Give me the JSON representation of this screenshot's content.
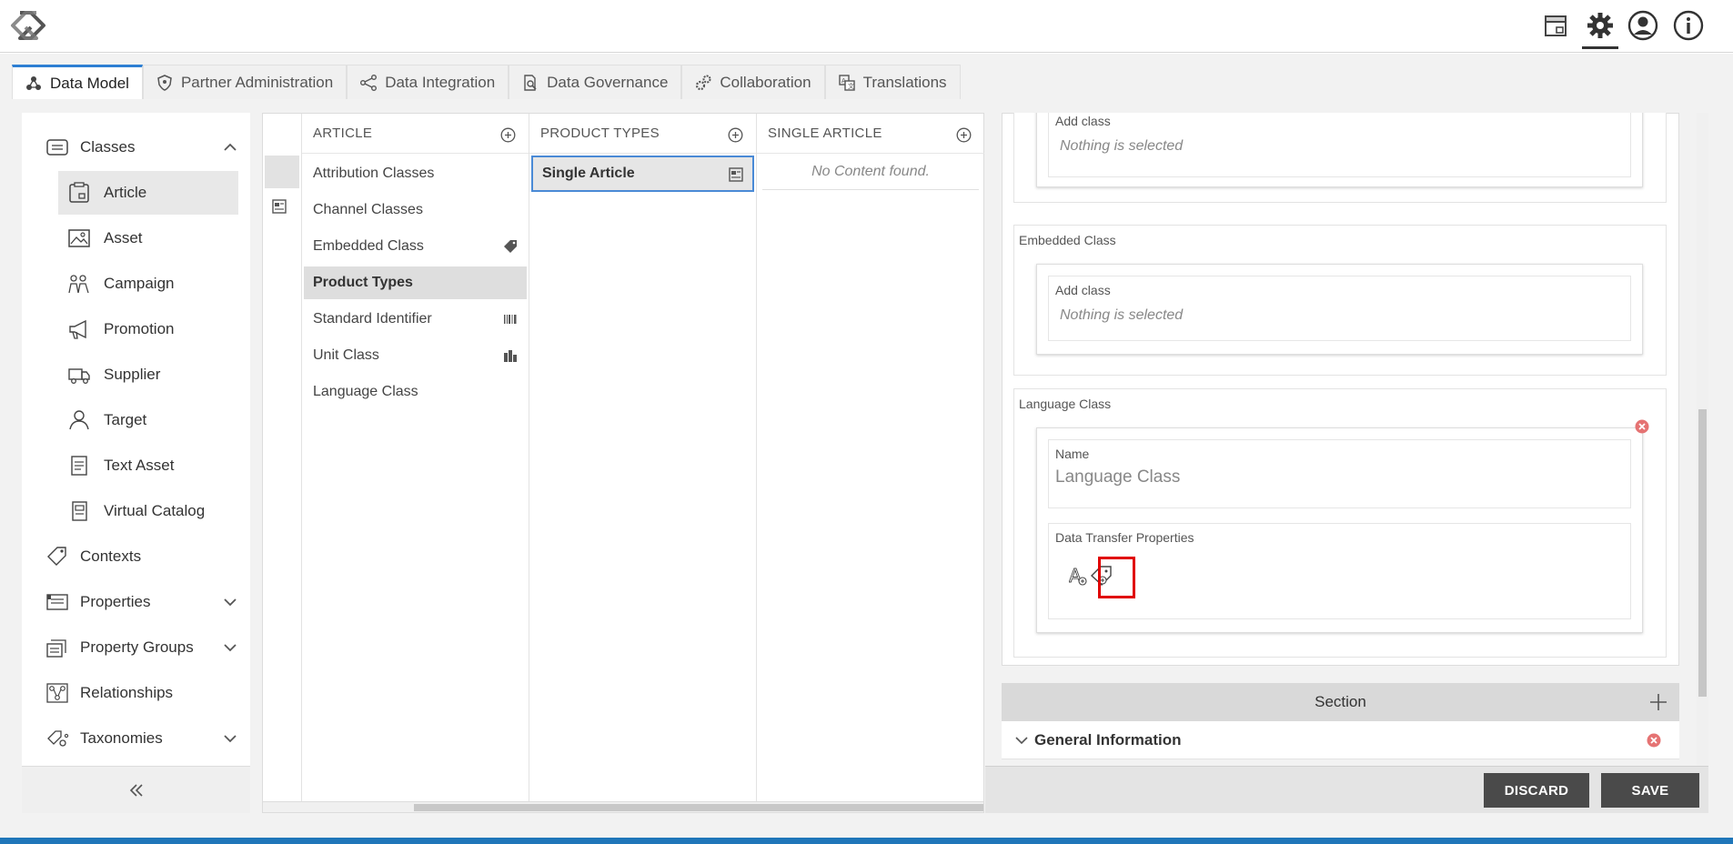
{
  "header": {
    "icons": [
      "logo-icon",
      "package-icon",
      "gear-icon",
      "user-icon",
      "info-icon"
    ]
  },
  "tabs": [
    {
      "label": "Data Model",
      "icon": "network-icon",
      "active": true
    },
    {
      "label": "Partner Administration",
      "icon": "shield-icon"
    },
    {
      "label": "Data Integration",
      "icon": "share-icon"
    },
    {
      "label": "Data Governance",
      "icon": "document-search-icon"
    },
    {
      "label": "Collaboration",
      "icon": "gears-icon"
    },
    {
      "label": "Translations",
      "icon": "translate-icon"
    }
  ],
  "sidebar": {
    "items": [
      {
        "label": "Classes",
        "icon": "classes-icon",
        "expanded": true
      },
      {
        "label": "Article",
        "icon": "article-icon",
        "selected": true
      },
      {
        "label": "Asset",
        "icon": "image-icon"
      },
      {
        "label": "Campaign",
        "icon": "campaign-icon"
      },
      {
        "label": "Promotion",
        "icon": "megaphone-icon"
      },
      {
        "label": "Supplier",
        "icon": "truck-icon"
      },
      {
        "label": "Target",
        "icon": "person-icon"
      },
      {
        "label": "Text Asset",
        "icon": "text-document-icon"
      },
      {
        "label": "Virtual Catalog",
        "icon": "catalog-icon"
      },
      {
        "label": "Contexts",
        "icon": "tag-icon"
      },
      {
        "label": "Properties",
        "icon": "properties-icon",
        "expandable": true
      },
      {
        "label": "Property Groups",
        "icon": "property-groups-icon",
        "expandable": true
      },
      {
        "label": "Relationships",
        "icon": "relationships-icon"
      },
      {
        "label": "Taxonomies",
        "icon": "taxonomy-icon",
        "expandable": true
      }
    ],
    "collapse_icon": "double-chevron-left-icon"
  },
  "columns": {
    "article": {
      "header": "ARTICLE",
      "rows": [
        {
          "label": "Attribution Classes"
        },
        {
          "label": "Channel Classes"
        },
        {
          "label": "Embedded Class",
          "icon": "tag-icon"
        },
        {
          "label": "Product Types",
          "selected": true
        },
        {
          "label": "Standard Identifier",
          "icon": "barcode-icon"
        },
        {
          "label": "Unit Class",
          "icon": "units-icon"
        },
        {
          "label": "Language Class"
        }
      ]
    },
    "product_types": {
      "header": "PRODUCT TYPES",
      "rows": [
        {
          "label": "Single Article",
          "icon": "form-icon",
          "selected": true
        }
      ]
    },
    "single_article": {
      "header": "SINGLE ARTICLE",
      "empty_text": "No Content found."
    }
  },
  "detail": {
    "top_block": {
      "field_label": "Add class",
      "field_value": "Nothing is selected"
    },
    "embedded_block": {
      "title": "Embedded Class",
      "field_label": "Add class",
      "field_value": "Nothing is selected"
    },
    "language_block": {
      "title": "Language Class",
      "name_label": "Name",
      "name_value": "Language Class",
      "dtp_label": "Data Transfer Properties",
      "dtp_icons": [
        "text-property-icon",
        "tag-add-icon"
      ]
    },
    "section_label": "Section",
    "general_information": "General Information"
  },
  "actions": {
    "discard": "DISCARD",
    "save": "SAVE"
  },
  "colors": {
    "accent": "#2d7fd3",
    "highlight": "#e00000",
    "remove": "#e57373",
    "button": "#4a4a4a"
  }
}
